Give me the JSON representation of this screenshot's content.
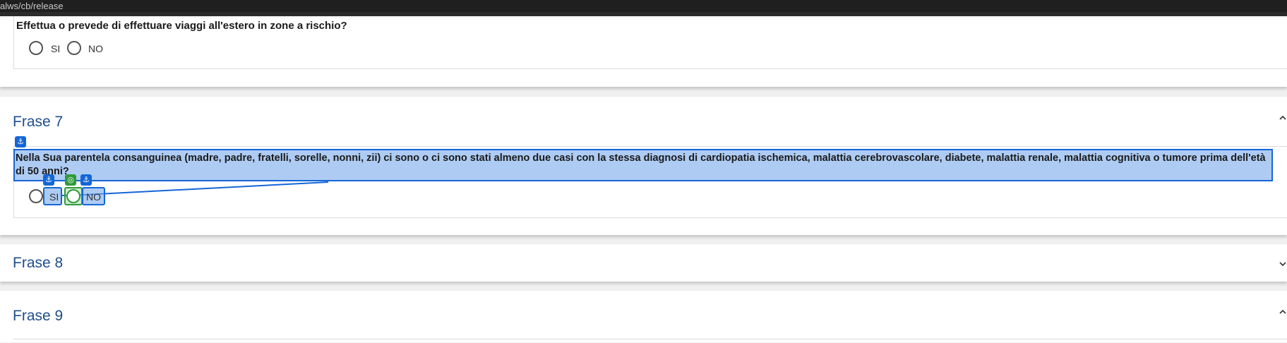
{
  "address_bar": {
    "url": "alws/cb/release"
  },
  "previous_question": {
    "text": "Effettua o prevede di effettuare viaggi all'estero in zone a rischio?",
    "options": [
      "SI",
      "NO"
    ]
  },
  "sections": [
    {
      "title": "Frase 7",
      "question": "Nella Sua parentela consanguinea (madre, padre, fratelli, sorelle, nonni, zii) ci sono o ci sono stati almeno due casi con la stessa diagnosi di cardiopatia ischemica, malattia cerebrovascolare, diabete, malattia renale, malattia cognitiva o tumore prima dell'età di 50 anni?",
      "options": [
        "SI",
        "NO"
      ],
      "expanded": true
    },
    {
      "title": "Frase 8",
      "expanded": false
    },
    {
      "title": "Frase 9",
      "expanded": true
    }
  ],
  "annotation_icons": [
    "anchor-icon",
    "target-icon"
  ],
  "colors": {
    "section_title": "#1f4e8c",
    "highlight_fill": "#78aaeb",
    "highlight_border": "#1466d8",
    "target_badge": "#2f9a3a"
  }
}
